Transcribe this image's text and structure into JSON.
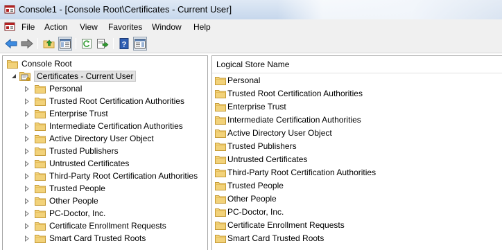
{
  "window": {
    "title": "Console1 - [Console Root\\Certificates - Current User]"
  },
  "menu": {
    "items": [
      "File",
      "Action",
      "View",
      "Favorites",
      "Window",
      "Help"
    ]
  },
  "toolbar": {
    "buttons": [
      "back-icon",
      "forward-icon",
      "up-folder-icon",
      "show-hide-tree-icon",
      "refresh-icon",
      "export-list-icon",
      "help-icon",
      "show-hide-action-pane-icon"
    ]
  },
  "tree": {
    "root_label": "Console Root",
    "snapin_label": "Certificates - Current User",
    "stores": [
      "Personal",
      "Trusted Root Certification Authorities",
      "Enterprise Trust",
      "Intermediate Certification Authorities",
      "Active Directory User Object",
      "Trusted Publishers",
      "Untrusted Certificates",
      "Third-Party Root Certification Authorities",
      "Trusted People",
      "Other People",
      "PC-Doctor, Inc.",
      "Certificate Enrollment Requests",
      "Smart Card Trusted Roots"
    ]
  },
  "list": {
    "column_header": "Logical Store Name",
    "items": [
      "Personal",
      "Trusted Root Certification Authorities",
      "Enterprise Trust",
      "Intermediate Certification Authorities",
      "Active Directory User Object",
      "Trusted Publishers",
      "Untrusted Certificates",
      "Third-Party Root Certification Authorities",
      "Trusted People",
      "Other People",
      "PC-Doctor, Inc.",
      "Certificate Enrollment Requests",
      "Smart Card Trusted Roots"
    ]
  },
  "colors": {
    "folder_fill": "#f2d27a",
    "folder_edge": "#c59a35",
    "selection_bg": "#e3e3e3"
  }
}
